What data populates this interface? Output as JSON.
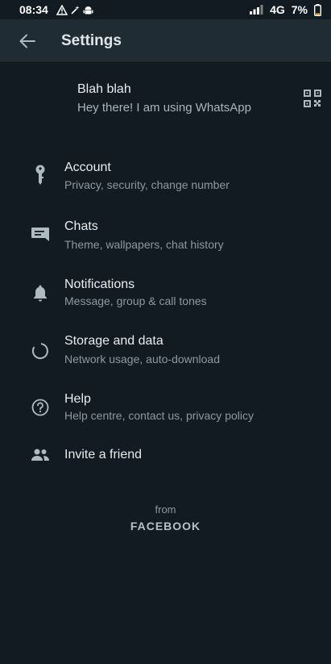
{
  "status_bar": {
    "time": "08:34",
    "network": "4G",
    "battery": "7%"
  },
  "app_bar": {
    "title": "Settings",
    "back_icon": "arrow-left-icon"
  },
  "profile": {
    "name": "Blah blah",
    "about": "Hey there! I am using WhatsApp",
    "qr_icon": "qr-code-icon"
  },
  "settings": {
    "items": [
      {
        "label": "Account",
        "description": "Privacy, security, change number",
        "icon": "key-icon"
      },
      {
        "label": "Chats",
        "description": "Theme, wallpapers, chat history",
        "icon": "chat-icon"
      },
      {
        "label": "Notifications",
        "description": "Message, group & call tones",
        "icon": "bell-icon"
      },
      {
        "label": "Storage and data",
        "description": "Network usage, auto-download",
        "icon": "data-usage-icon"
      },
      {
        "label": "Help",
        "description": "Help centre, contact us, privacy policy",
        "icon": "help-icon"
      },
      {
        "label": "Invite a friend",
        "description": "",
        "icon": "people-icon"
      }
    ]
  },
  "footer": {
    "from": "from",
    "brand": "FACEBOOK"
  },
  "colors": {
    "background": "#121b22",
    "app_bar": "#1f2c33",
    "primary_text": "#e9edef",
    "secondary_text": "#8d989f",
    "icon": "#aebac1"
  }
}
